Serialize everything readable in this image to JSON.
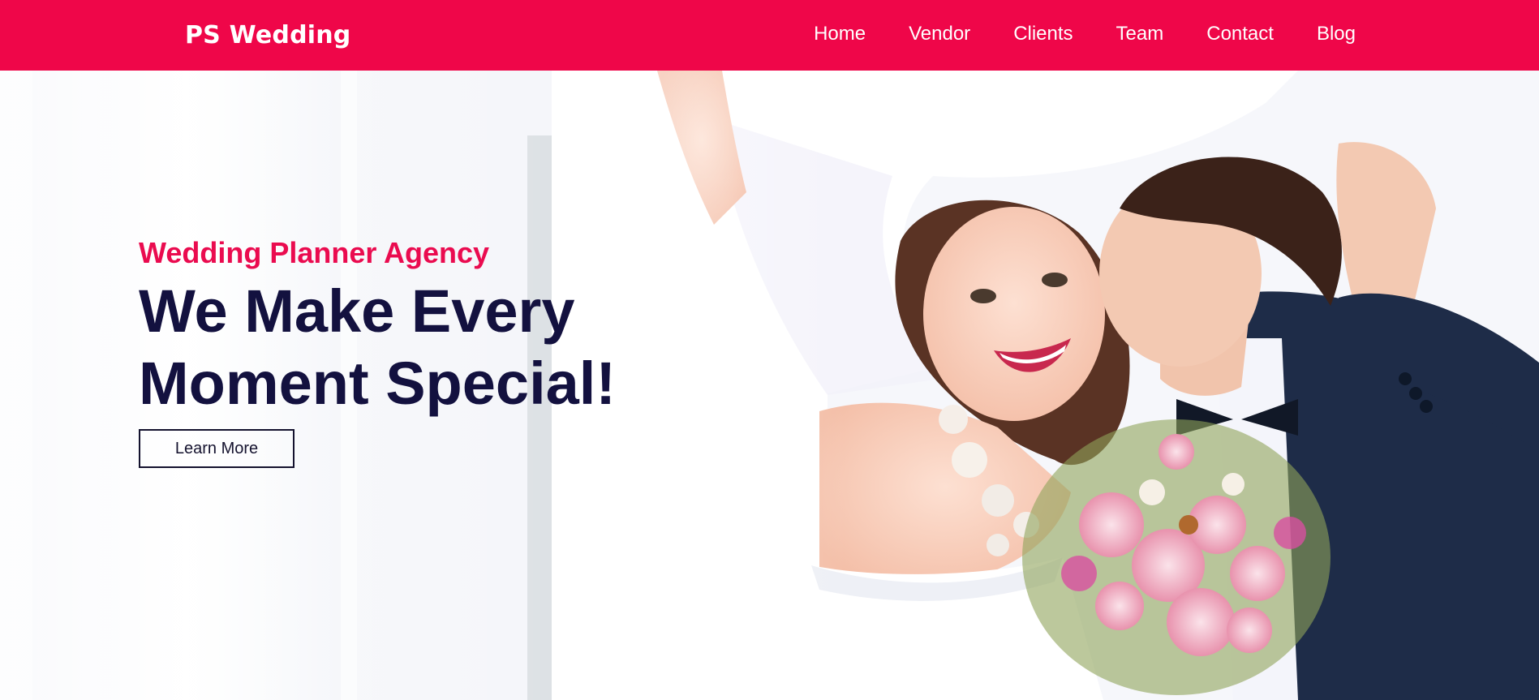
{
  "navbar": {
    "brand": "PS Wedding",
    "links": [
      "Home",
      "Vendor",
      "Clients",
      "Team",
      "Contact",
      "Blog"
    ]
  },
  "hero": {
    "subtitle": "Wedding Planner Agency",
    "title_line1": "We Make Every",
    "title_line2": "Moment Special!",
    "button_label": "Learn More"
  },
  "colors": {
    "brand": "#ef0649",
    "heading": "#13113f",
    "accent_text": "#ea0b4f"
  }
}
